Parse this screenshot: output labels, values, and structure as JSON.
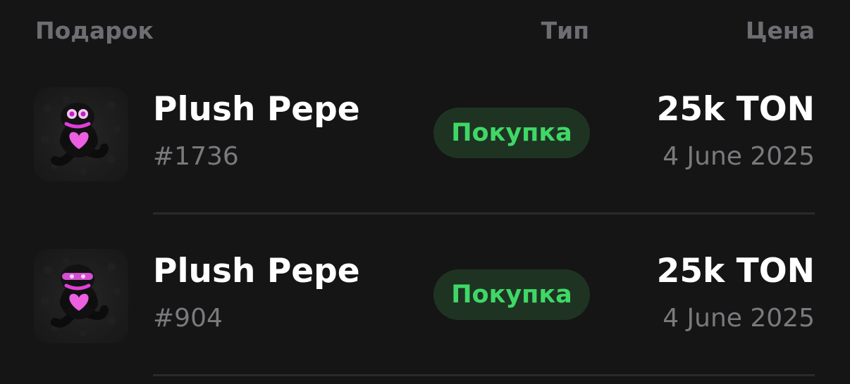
{
  "header": {
    "gift_label": "Подарок",
    "type_label": "Тип",
    "price_label": "Цена"
  },
  "rows": [
    {
      "name": "Plush Pepe",
      "number": "#1736",
      "type": "Покупка",
      "price": "25k TON",
      "date": "4 June 2025",
      "icon": "plush-pepe-icon"
    },
    {
      "name": "Plush Pepe",
      "number": "#904",
      "type": "Покупка",
      "price": "25k TON",
      "date": "4 June 2025",
      "icon": "plush-pepe-icon"
    }
  ],
  "colors": {
    "background": "#151515",
    "badge_bg": "#1f3323",
    "badge_text": "#3fd866",
    "secondary_text": "#7a7a7e",
    "header_text": "#6e6e72"
  }
}
